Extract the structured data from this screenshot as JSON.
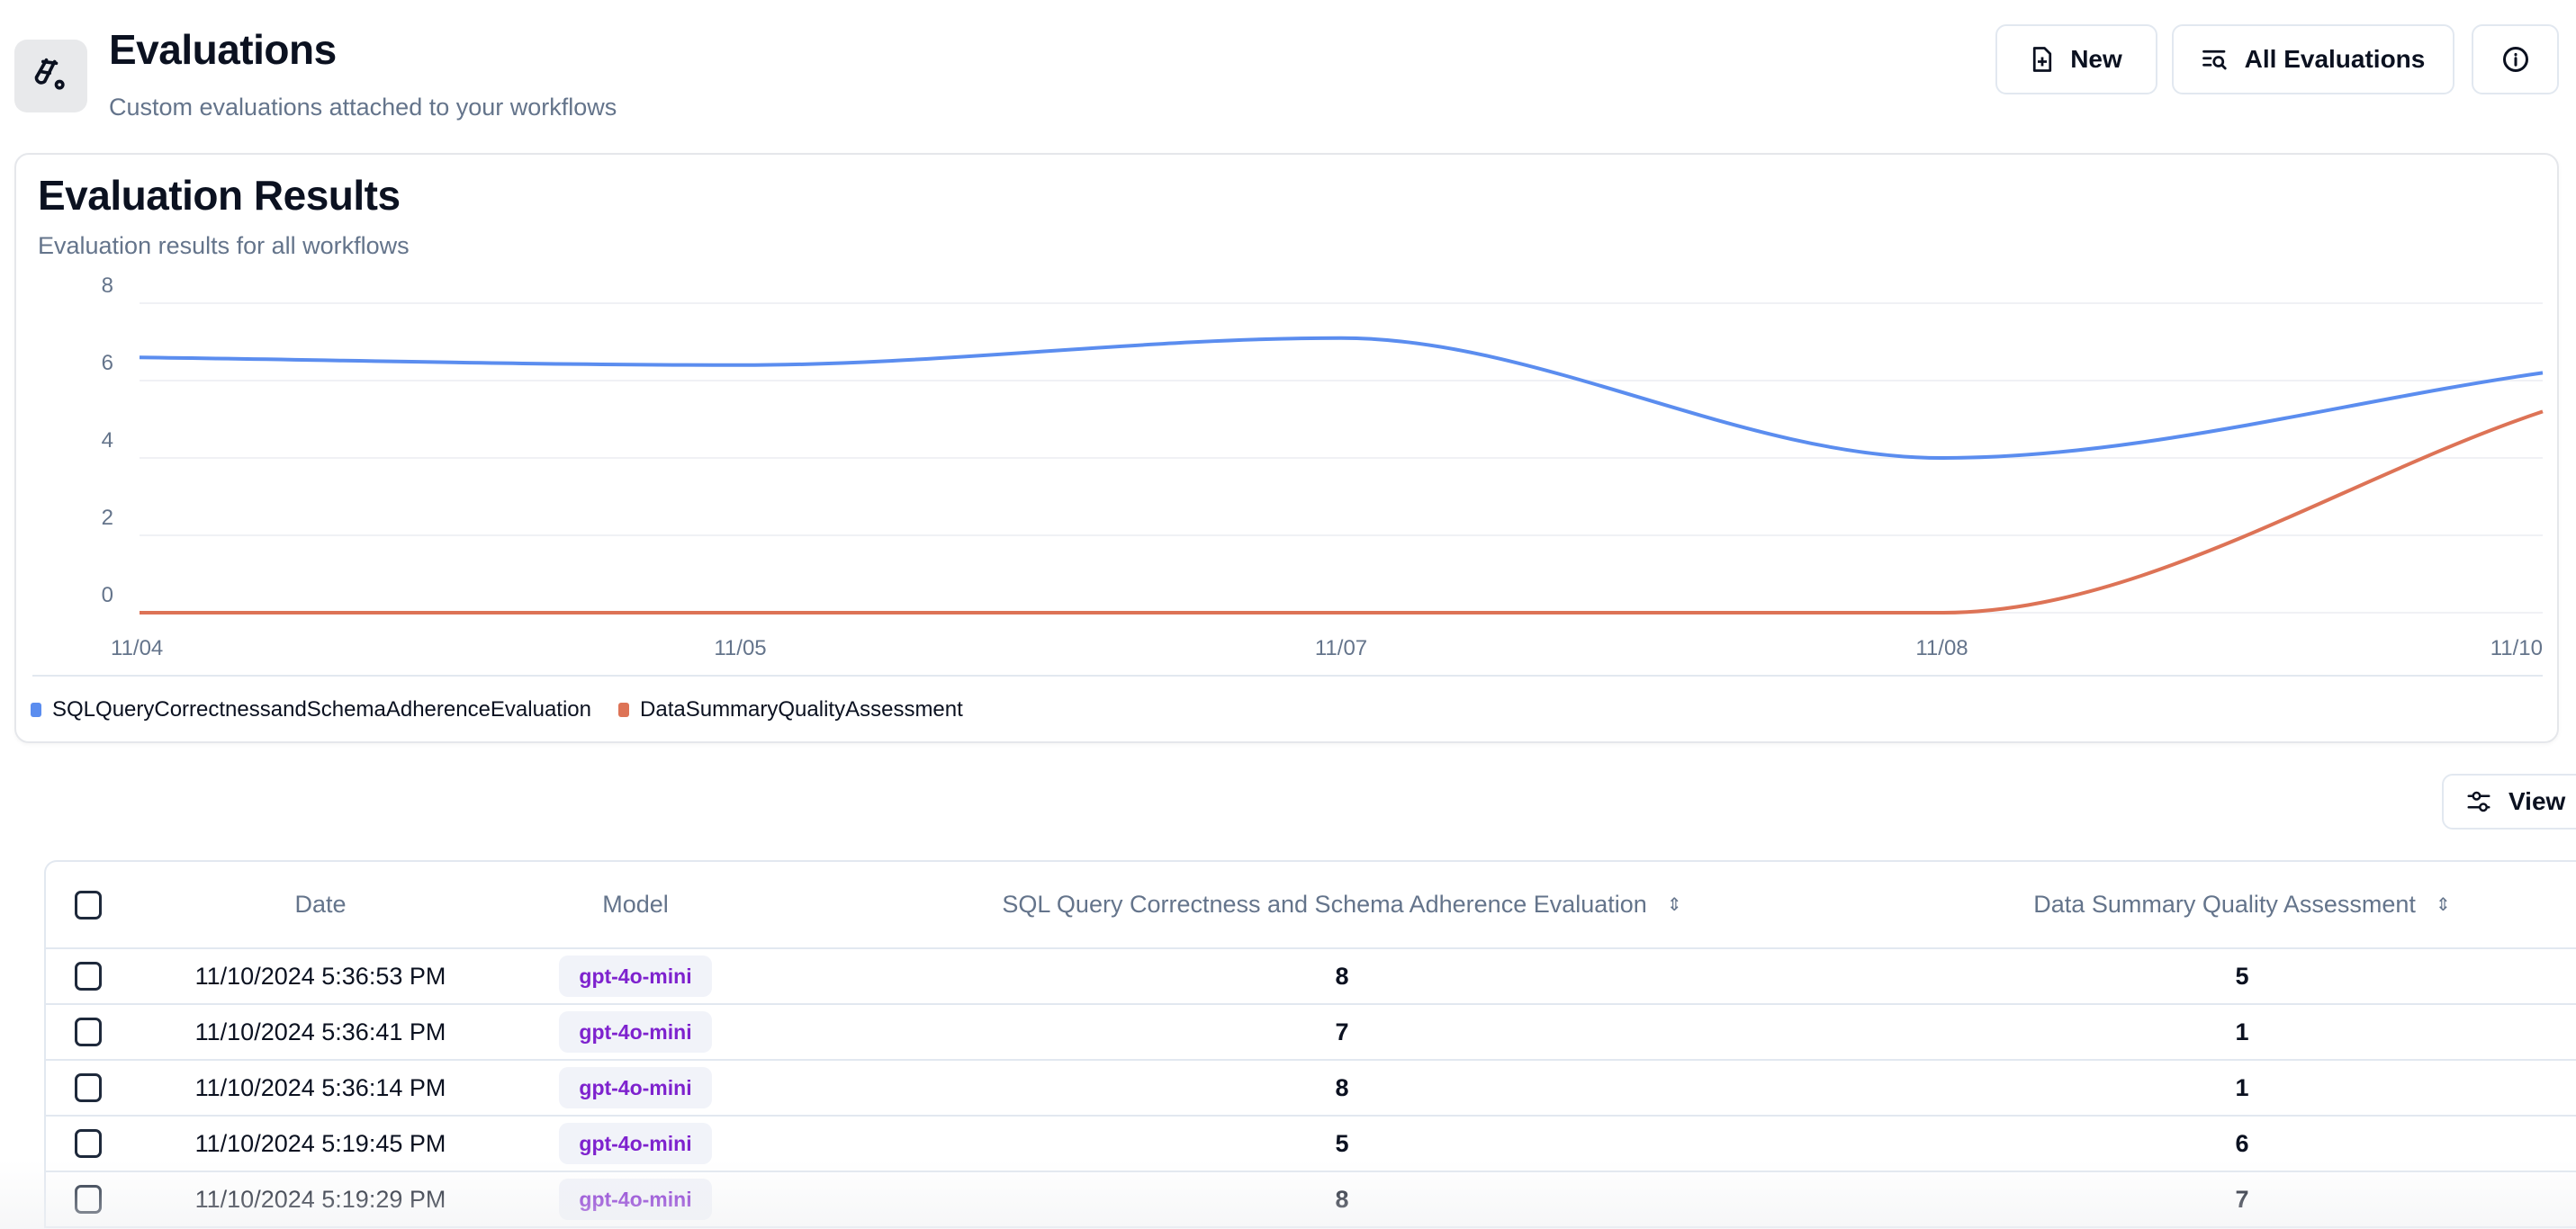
{
  "header": {
    "title": "Evaluations",
    "subtitle": "Custom evaluations attached to your workflows",
    "icon": "test-tube-icon",
    "buttons": {
      "new": "New",
      "all_evaluations": "All Evaluations"
    }
  },
  "results_card": {
    "title": "Evaluation Results",
    "subtitle": "Evaluation results for all workflows"
  },
  "chart_data": {
    "type": "line",
    "categories": [
      "11/04",
      "11/05",
      "11/07",
      "11/08",
      "11/10"
    ],
    "series": [
      {
        "name": "SQLQueryCorrectnessandSchemaAdherenceEvaluation",
        "color": "#5b8def",
        "values": [
          6.6,
          6.4,
          7.1,
          4.0,
          6.2
        ]
      },
      {
        "name": "DataSummaryQualityAssessment",
        "color": "#dd7356",
        "values": [
          0,
          0,
          0,
          0,
          5.2
        ]
      }
    ],
    "yticks": [
      "0",
      "2",
      "4",
      "6",
      "8"
    ],
    "ylim": [
      0,
      8
    ],
    "grid": true,
    "legend": "bottom-left",
    "curve": "smooth"
  },
  "toolbar": {
    "view": "View"
  },
  "table": {
    "columns": {
      "date": "Date",
      "model": "Model",
      "sql": "SQL Query Correctness and Schema Adherence Evaluation",
      "dsq": "Data Summary Quality Assessment"
    },
    "rows": [
      {
        "date": "11/10/2024 5:36:53 PM",
        "model": "gpt-4o-mini",
        "sql": "8",
        "dsq": "5"
      },
      {
        "date": "11/10/2024 5:36:41 PM",
        "model": "gpt-4o-mini",
        "sql": "7",
        "dsq": "1"
      },
      {
        "date": "11/10/2024 5:36:14 PM",
        "model": "gpt-4o-mini",
        "sql": "8",
        "dsq": "1"
      },
      {
        "date": "11/10/2024 5:19:45 PM",
        "model": "gpt-4o-mini",
        "sql": "5",
        "dsq": "6"
      },
      {
        "date": "11/10/2024 5:19:29 PM",
        "model": "gpt-4o-mini",
        "sql": "8",
        "dsq": "7"
      }
    ]
  }
}
